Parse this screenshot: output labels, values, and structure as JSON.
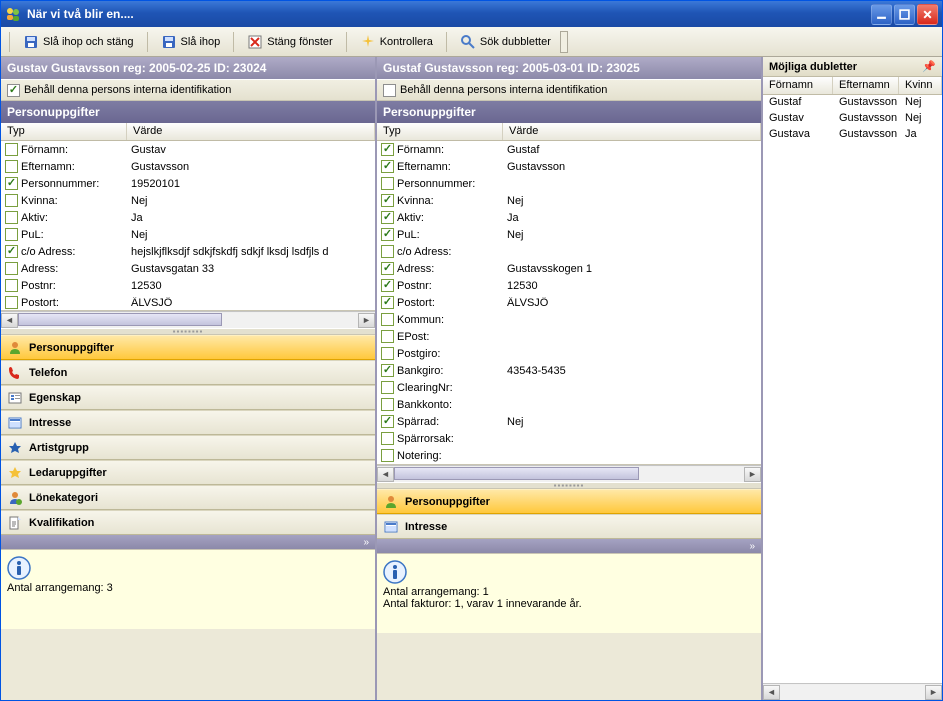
{
  "window": {
    "title": "När vi två blir en...."
  },
  "toolbar": {
    "merge_close": "Slå ihop och stäng",
    "merge": "Slå ihop",
    "close_windows": "Stäng fönster",
    "check": "Kontrollera",
    "search_dup": "Sök dubbletter"
  },
  "left": {
    "header": "Gustav Gustavsson reg: 2005-02-25 ID: 23024",
    "keep_label": "Behåll denna persons interna identifikation",
    "keep_checked": true,
    "section": "Personuppgifter",
    "cols": {
      "typ": "Typ",
      "varde": "Värde"
    },
    "rows": [
      {
        "label": "Förnamn:",
        "value": "Gustav",
        "c": false
      },
      {
        "label": "Efternamn:",
        "value": "Gustavsson",
        "c": false
      },
      {
        "label": "Personnummer:",
        "value": "19520101",
        "c": true
      },
      {
        "label": "Kvinna:",
        "value": "Nej",
        "c": false
      },
      {
        "label": "Aktiv:",
        "value": "Ja",
        "c": false
      },
      {
        "label": "PuL:",
        "value": "Nej",
        "c": false
      },
      {
        "label": "c/o Adress:",
        "value": "hejslkjflksdjf sdkjfskdfj sdkjf lksdj lsdfjls d",
        "c": true
      },
      {
        "label": "Adress:",
        "value": "Gustavsgatan 33",
        "c": false
      },
      {
        "label": "Postnr:",
        "value": "12530",
        "c": false
      },
      {
        "label": "Postort:",
        "value": "ÄLVSJÖ",
        "c": false
      }
    ],
    "nav": [
      {
        "label": "Personuppgifter",
        "icon": "person-icon",
        "active": true
      },
      {
        "label": "Telefon",
        "icon": "phone-icon",
        "active": false
      },
      {
        "label": "Egenskap",
        "icon": "property-icon",
        "active": false
      },
      {
        "label": "Intresse",
        "icon": "interest-icon",
        "active": false
      },
      {
        "label": "Artistgrupp",
        "icon": "artist-icon",
        "active": false
      },
      {
        "label": "Ledaruppgifter",
        "icon": "leader-icon",
        "active": false
      },
      {
        "label": "Lönekategori",
        "icon": "salary-icon",
        "active": false
      },
      {
        "label": "Kvalifikation",
        "icon": "qualification-icon",
        "active": false
      }
    ],
    "info_lines": [
      "Antal arrangemang: 3"
    ]
  },
  "mid": {
    "header": "Gustaf Gustavsson reg: 2005-03-01 ID: 23025",
    "keep_label": "Behåll denna persons interna identifikation",
    "keep_checked": false,
    "section": "Personuppgifter",
    "cols": {
      "typ": "Typ",
      "varde": "Värde"
    },
    "rows": [
      {
        "label": "Förnamn:",
        "value": "Gustaf",
        "c": true
      },
      {
        "label": "Efternamn:",
        "value": "Gustavsson",
        "c": true
      },
      {
        "label": "Personnummer:",
        "value": "",
        "c": false
      },
      {
        "label": "Kvinna:",
        "value": "Nej",
        "c": true
      },
      {
        "label": "Aktiv:",
        "value": "Ja",
        "c": true
      },
      {
        "label": "PuL:",
        "value": "Nej",
        "c": true
      },
      {
        "label": "c/o Adress:",
        "value": "",
        "c": false
      },
      {
        "label": "Adress:",
        "value": "Gustavsskogen 1",
        "c": true
      },
      {
        "label": "Postnr:",
        "value": "12530",
        "c": true
      },
      {
        "label": "Postort:",
        "value": "ÄLVSJÖ",
        "c": true
      },
      {
        "label": "Kommun:",
        "value": "",
        "c": false
      },
      {
        "label": "EPost:",
        "value": "",
        "c": false
      },
      {
        "label": "Postgiro:",
        "value": "",
        "c": false
      },
      {
        "label": "Bankgiro:",
        "value": "43543-5435",
        "c": true
      },
      {
        "label": "ClearingNr:",
        "value": "",
        "c": false
      },
      {
        "label": "Bankkonto:",
        "value": "",
        "c": false
      },
      {
        "label": "Spärrad:",
        "value": "Nej",
        "c": true
      },
      {
        "label": "Spärrorsak:",
        "value": "",
        "c": false
      },
      {
        "label": "Notering:",
        "value": "",
        "c": false
      }
    ],
    "nav": [
      {
        "label": "Personuppgifter",
        "icon": "person-icon",
        "active": true
      },
      {
        "label": "Intresse",
        "icon": "interest-icon",
        "active": false
      }
    ],
    "info_lines": [
      "Antal arrangemang: 1",
      "Antal fakturor: 1, varav 1 innevarande år."
    ]
  },
  "right": {
    "title": "Möjliga dubletter",
    "cols": {
      "fn": "Förnamn",
      "en": "Efternamn",
      "kv": "Kvinn"
    },
    "rows": [
      {
        "fn": "Gustaf",
        "en": "Gustavsson",
        "kv": "Nej"
      },
      {
        "fn": "Gustav",
        "en": "Gustavsson",
        "kv": "Nej"
      },
      {
        "fn": "Gustava",
        "en": "Gustavsson",
        "kv": "Ja"
      }
    ]
  },
  "expand_glyph": "»"
}
